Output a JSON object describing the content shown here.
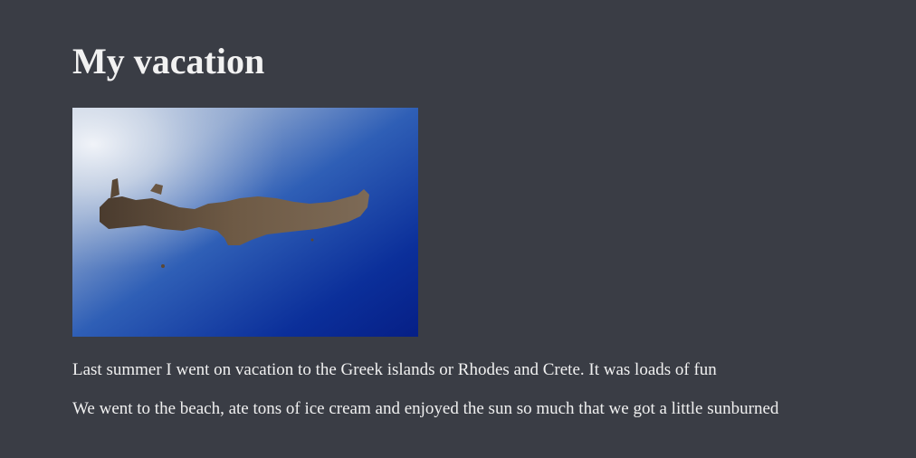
{
  "page": {
    "title": "My vacation",
    "paragraphs": [
      "Last summer I went on vacation to the Greek islands or Rhodes and Crete. It was loads of fun",
      "We went to the beach, ate tons of ice cream and enjoyed the sun so much that we got a little sunburned"
    ]
  },
  "colors": {
    "background": "#3a3d45",
    "text": "#f0f0f0"
  }
}
